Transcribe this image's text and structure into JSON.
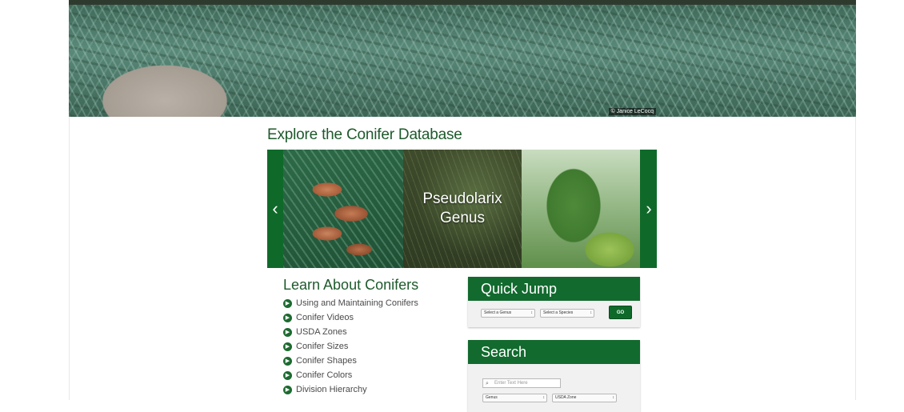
{
  "hero": {
    "credit": "© Janice LeCocq"
  },
  "explore": {
    "title": "Explore the Conifer Database",
    "carousel": {
      "caption_line1": "Pseudolarix",
      "caption_line2": "Genus",
      "prev_icon": "chevron-left-icon",
      "next_icon": "chevron-right-icon"
    }
  },
  "learn": {
    "title": "Learn About Conifers",
    "links": [
      "Using and Maintaining Conifers",
      "Conifer Videos",
      "USDA Zones",
      "Conifer Sizes",
      "Conifer Shapes",
      "Conifer Colors",
      "Division Hierarchy"
    ]
  },
  "quick_jump": {
    "title": "Quick Jump",
    "genus_select": "Select a Genus",
    "species_select": "Select a Species",
    "go_label": "GO"
  },
  "search": {
    "title": "Search",
    "text_placeholder": "Enter Text Here",
    "genus_select": "Genus",
    "zone_select": "USDA Zone"
  },
  "colors": {
    "brand_green": "#126a2e",
    "heading_green": "#1e5a2c"
  }
}
